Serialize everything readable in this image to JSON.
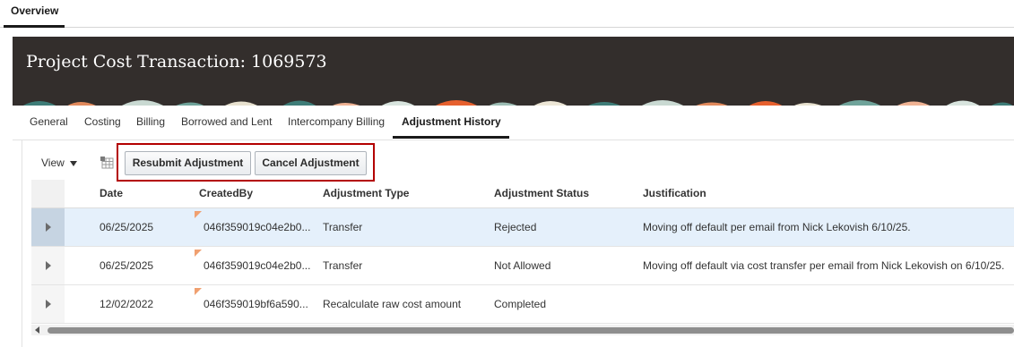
{
  "top_tabs": [
    {
      "label": "Overview",
      "active": true
    }
  ],
  "banner": {
    "title": "Project Cost Transaction: 1069573"
  },
  "sub_tabs": [
    {
      "label": "General",
      "active": false
    },
    {
      "label": "Costing",
      "active": false
    },
    {
      "label": "Billing",
      "active": false
    },
    {
      "label": "Borrowed and Lent",
      "active": false
    },
    {
      "label": "Intercompany Billing",
      "active": false
    },
    {
      "label": "Adjustment History",
      "active": true
    }
  ],
  "toolbar": {
    "view_label": "View",
    "resubmit_label": "Resubmit Adjustment",
    "cancel_label": "Cancel Adjustment"
  },
  "table": {
    "columns": [
      "Date",
      "CreatedBy",
      "Adjustment Type",
      "Adjustment Status",
      "Justification"
    ],
    "rows": [
      {
        "date": "06/25/2025",
        "created_by": "046f359019c04e2b0...",
        "type": "Transfer",
        "status": "Rejected",
        "justification": "Moving off default per email from Nick Lekovish 6/10/25.",
        "selected": true
      },
      {
        "date": "06/25/2025",
        "created_by": "046f359019c04e2b0...",
        "type": "Transfer",
        "status": "Not Allowed",
        "justification": "Moving off default via cost transfer per email from Nick Lekovish on 6/10/25.",
        "selected": false
      },
      {
        "date": "12/02/2022",
        "created_by": "046f359019bf6a590...",
        "type": "Recalculate raw cost amount",
        "status": "Completed",
        "justification": "",
        "selected": false
      }
    ]
  },
  "colors": {
    "banner_bg": "#332e2c",
    "highlight_border": "#b30000",
    "selected_row": "#e5f0fb"
  },
  "icons": [
    "chevron-down-icon",
    "table-settings-icon",
    "row-expand-icon",
    "scroll-left-icon"
  ]
}
